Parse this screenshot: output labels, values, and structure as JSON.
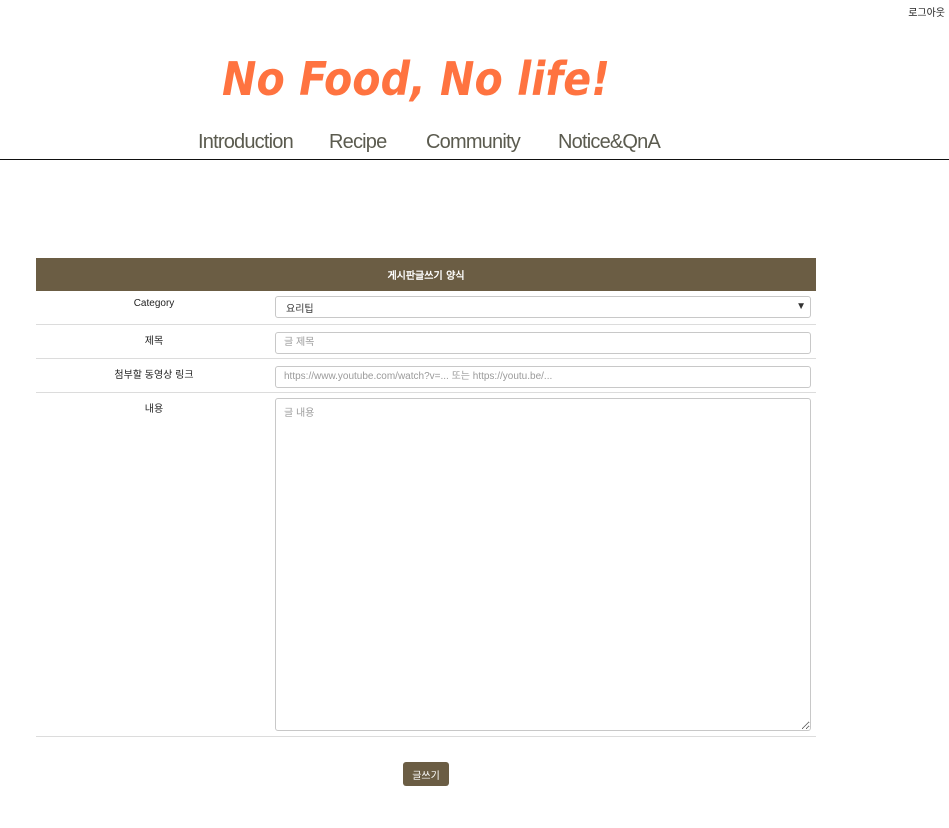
{
  "header": {
    "logout_label": "로그아웃",
    "logo_text": "No Food, No life!",
    "logo_color": "#ff7340"
  },
  "nav": {
    "items": [
      {
        "label": "Introduction"
      },
      {
        "label": "Recipe"
      },
      {
        "label": "Community"
      },
      {
        "label": "Notice&QnA"
      }
    ]
  },
  "form": {
    "title": "게시판글쓰기 양식",
    "header_color": "#6b5d44",
    "category_label": "Category",
    "category_value": "요리팁",
    "title_label": "제목",
    "title_placeholder": "글 제목",
    "video_label": "첨부할 동영상 링크",
    "video_placeholder": "https://www.youtube.com/watch?v=... 또는 https://youtu.be/...",
    "content_label": "내용",
    "content_placeholder": "글 내용",
    "submit_label": "글쓰기"
  }
}
